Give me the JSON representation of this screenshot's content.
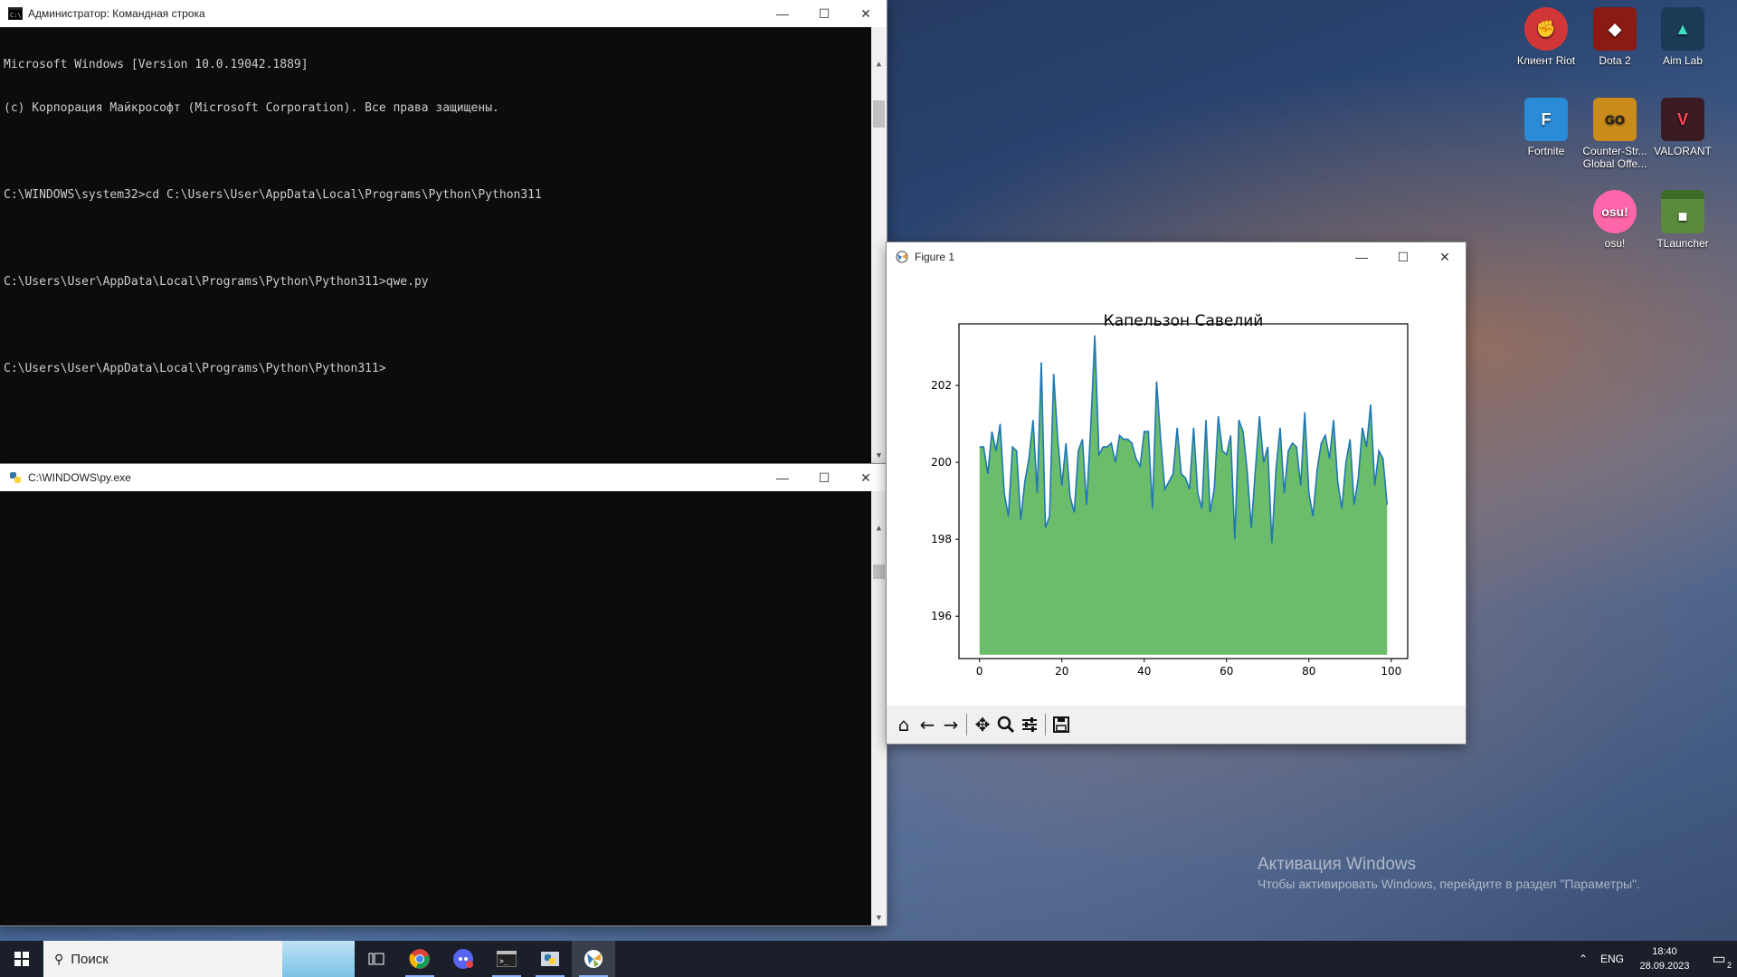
{
  "desktop": {
    "icons": [
      {
        "label": "Клиент Riot"
      },
      {
        "label": "Dota 2"
      },
      {
        "label": "Aim Lab"
      },
      {
        "label": "Fortnite"
      },
      {
        "label": "Counter-Str... Global Offe..."
      },
      {
        "label": "VALORANT"
      },
      {
        "label": "osu!"
      },
      {
        "label": "TLauncher"
      }
    ],
    "watermark_title": "Активация Windows",
    "watermark_text": "Чтобы активировать Windows, перейдите в раздел \"Параметры\"."
  },
  "cmd_window": {
    "title": "Администратор: Командная строка",
    "lines": [
      "Microsoft Windows [Version 10.0.19042.1889]",
      "(c) Корпорация Майкрософт (Microsoft Corporation). Все права защищены.",
      "",
      "C:\\WINDOWS\\system32>cd C:\\Users\\User\\AppData\\Local\\Programs\\Python\\Python311",
      "",
      "C:\\Users\\User\\AppData\\Local\\Programs\\Python\\Python311>qwe.py",
      "",
      "C:\\Users\\User\\AppData\\Local\\Programs\\Python\\Python311>"
    ]
  },
  "py_window": {
    "title": "C:\\WINDOWS\\py.exe"
  },
  "figure_window": {
    "title": "Figure 1"
  },
  "window_controls": {
    "minimize": "—",
    "maximize": "☐",
    "close": "✕"
  },
  "toolbar_icons": [
    "home-icon",
    "back-icon",
    "forward-icon",
    "pan-icon",
    "zoom-icon",
    "configure-icon",
    "save-icon"
  ],
  "chart_data": {
    "type": "area",
    "title": "Капельзон Савелий",
    "xlabel": "",
    "ylabel": "",
    "xlim": [
      -5,
      104
    ],
    "ylim": [
      194.9,
      203.6
    ],
    "xticks": [
      0,
      20,
      40,
      60,
      80,
      100
    ],
    "yticks": [
      196,
      198,
      200,
      202
    ],
    "fill_baseline": 195,
    "colors": {
      "line": "#1f77b4",
      "fill": "#2ca02c"
    },
    "x": [
      0,
      1,
      2,
      3,
      4,
      5,
      6,
      7,
      8,
      9,
      10,
      11,
      12,
      13,
      14,
      15,
      16,
      17,
      18,
      19,
      20,
      21,
      22,
      23,
      24,
      25,
      26,
      27,
      28,
      29,
      30,
      31,
      32,
      33,
      34,
      35,
      36,
      37,
      38,
      39,
      40,
      41,
      42,
      43,
      44,
      45,
      46,
      47,
      48,
      49,
      50,
      51,
      52,
      53,
      54,
      55,
      56,
      57,
      58,
      59,
      60,
      61,
      62,
      63,
      64,
      65,
      66,
      67,
      68,
      69,
      70,
      71,
      72,
      73,
      74,
      75,
      76,
      77,
      78,
      79,
      80,
      81,
      82,
      83,
      84,
      85,
      86,
      87,
      88,
      89,
      90,
      91,
      92,
      93,
      94,
      95,
      96,
      97,
      98,
      99
    ],
    "values": [
      200.4,
      200.4,
      199.7,
      200.8,
      200.3,
      201.0,
      199.2,
      198.6,
      200.4,
      200.3,
      198.5,
      199.5,
      200.1,
      201.1,
      199.2,
      202.6,
      198.3,
      198.6,
      202.3,
      200.6,
      199.4,
      200.5,
      199.1,
      198.7,
      200.3,
      200.6,
      198.9,
      200.9,
      203.3,
      200.2,
      200.4,
      200.4,
      200.5,
      200.0,
      200.7,
      200.6,
      200.6,
      200.5,
      200.1,
      199.9,
      200.8,
      200.8,
      198.8,
      202.1,
      200.6,
      199.3,
      199.5,
      199.7,
      200.9,
      199.7,
      199.6,
      199.3,
      200.9,
      199.2,
      198.8,
      201.1,
      198.7,
      199.3,
      201.2,
      200.3,
      200.2,
      200.7,
      198.0,
      201.1,
      200.8,
      199.8,
      198.3,
      199.8,
      201.2,
      200.0,
      200.4,
      197.9,
      199.8,
      200.9,
      199.2,
      200.3,
      200.5,
      200.4,
      199.4,
      201.3,
      199.2,
      198.6,
      199.8,
      200.5,
      200.7,
      200.1,
      201.1,
      199.5,
      198.8,
      200.0,
      200.6,
      198.9,
      199.6,
      200.9,
      200.4,
      201.5,
      199.4,
      200.3,
      200.1,
      198.9
    ]
  },
  "taskbar": {
    "search_placeholder": "Поиск",
    "lang": "ENG",
    "time": "18:40",
    "date": "28.09.2023",
    "notifications": "2"
  }
}
